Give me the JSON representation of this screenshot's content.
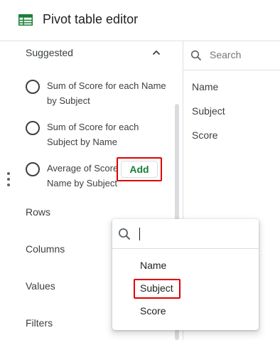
{
  "header": {
    "title": "Pivot table editor",
    "icon": "sheets-table-icon",
    "icon_color": "#188038"
  },
  "suggested": {
    "label": "Suggested",
    "items": [
      {
        "label": "Sum of Score for each Name by Subject"
      },
      {
        "label": "Sum of Score for each Subject by Name"
      },
      {
        "label": "Average of Score for each Name by Subject"
      }
    ]
  },
  "sections": {
    "rows": "Rows",
    "columns": "Columns",
    "values": "Values",
    "filters": "Filters"
  },
  "add_button": {
    "label": "Add",
    "color": "#188038"
  },
  "field_panel": {
    "search_placeholder": "Search",
    "fields": [
      "Name",
      "Subject",
      "Score"
    ]
  },
  "dropdown": {
    "search_value": "",
    "options": [
      "Name",
      "Subject",
      "Score"
    ]
  },
  "highlight_color": "#e00000"
}
